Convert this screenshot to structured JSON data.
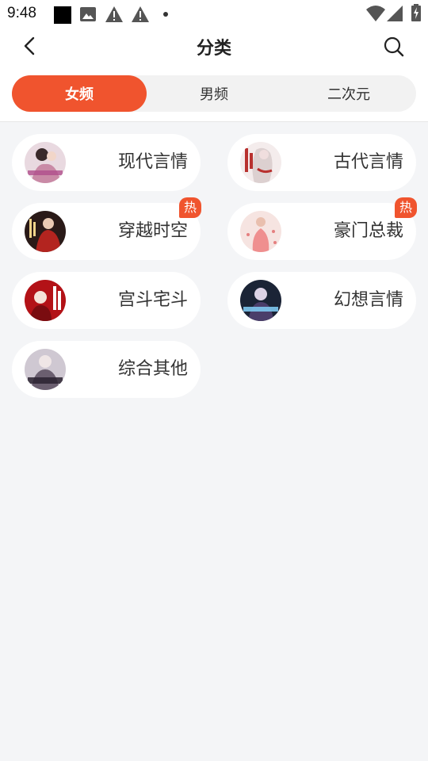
{
  "status_bar": {
    "time": "9:48",
    "icons": [
      "notification-square-icon",
      "image-icon",
      "warning-icon",
      "warning-icon",
      "dot-icon",
      "wifi-icon",
      "signal-icon",
      "battery-charging-icon"
    ]
  },
  "header": {
    "title": "分类",
    "back_icon": "chevron-left-icon",
    "search_icon": "search-icon"
  },
  "tabs": [
    {
      "label": "女频",
      "active": true
    },
    {
      "label": "男频",
      "active": false
    },
    {
      "label": "二次元",
      "active": false
    }
  ],
  "categories": [
    {
      "label": "现代言情",
      "hot": false
    },
    {
      "label": "古代言情",
      "hot": false
    },
    {
      "label": "穿越时空",
      "hot": true,
      "badge": "热"
    },
    {
      "label": "豪门总裁",
      "hot": true,
      "badge": "热"
    },
    {
      "label": "宫斗宅斗",
      "hot": false
    },
    {
      "label": "幻想言情",
      "hot": false
    },
    {
      "label": "综合其他",
      "hot": false
    }
  ],
  "colors": {
    "accent": "#f0542e",
    "background": "#f4f5f7",
    "card": "#ffffff"
  }
}
